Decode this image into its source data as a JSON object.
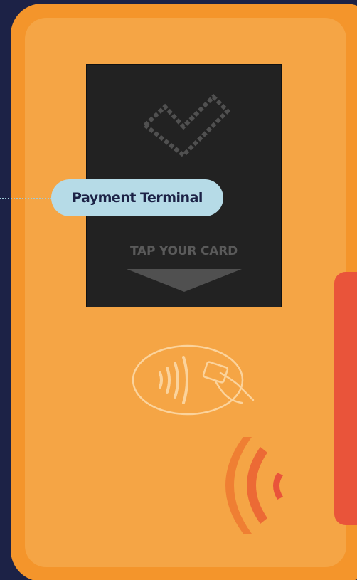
{
  "callout": {
    "label": "Payment Terminal"
  },
  "screen": {
    "prompt": "TAP YOUR CARD",
    "status_icon": "pixel-checkmark-icon",
    "pointer_icon": "down-arrow-icon"
  },
  "terminal": {
    "reader_icon": "contactless-card-icon",
    "nfc_icon": "nfc-waves-icon"
  },
  "colors": {
    "background": "#1c2246",
    "terminal_body": "#f4952b",
    "terminal_face": "#f5a545",
    "screen": "#222222",
    "callout": "#b6dbe7",
    "accent_red": "#e9543a"
  }
}
